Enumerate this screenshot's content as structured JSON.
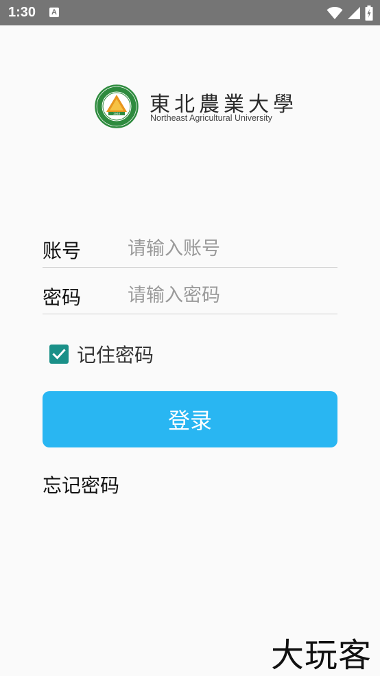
{
  "status_bar": {
    "time": "1:30",
    "notification_icon": "a-icon",
    "icons": [
      "wifi-icon",
      "cell-signal-icon",
      "battery-icon"
    ],
    "background": "#757575"
  },
  "logo": {
    "chinese_name": "東北農業大學",
    "english_name": "Northeast Agricultural University",
    "emblem_year": "1948"
  },
  "form": {
    "account": {
      "label": "账号",
      "placeholder": "请输入账号",
      "value": ""
    },
    "password": {
      "label": "密码",
      "placeholder": "请输入密码",
      "value": ""
    },
    "remember": {
      "label": "记住密码",
      "checked": true,
      "color": "#1a9088"
    }
  },
  "login_button": {
    "label": "登录",
    "color": "#29b6f2"
  },
  "forgot_link": {
    "label": "忘记密码"
  },
  "watermark": {
    "text": "大玩客"
  }
}
